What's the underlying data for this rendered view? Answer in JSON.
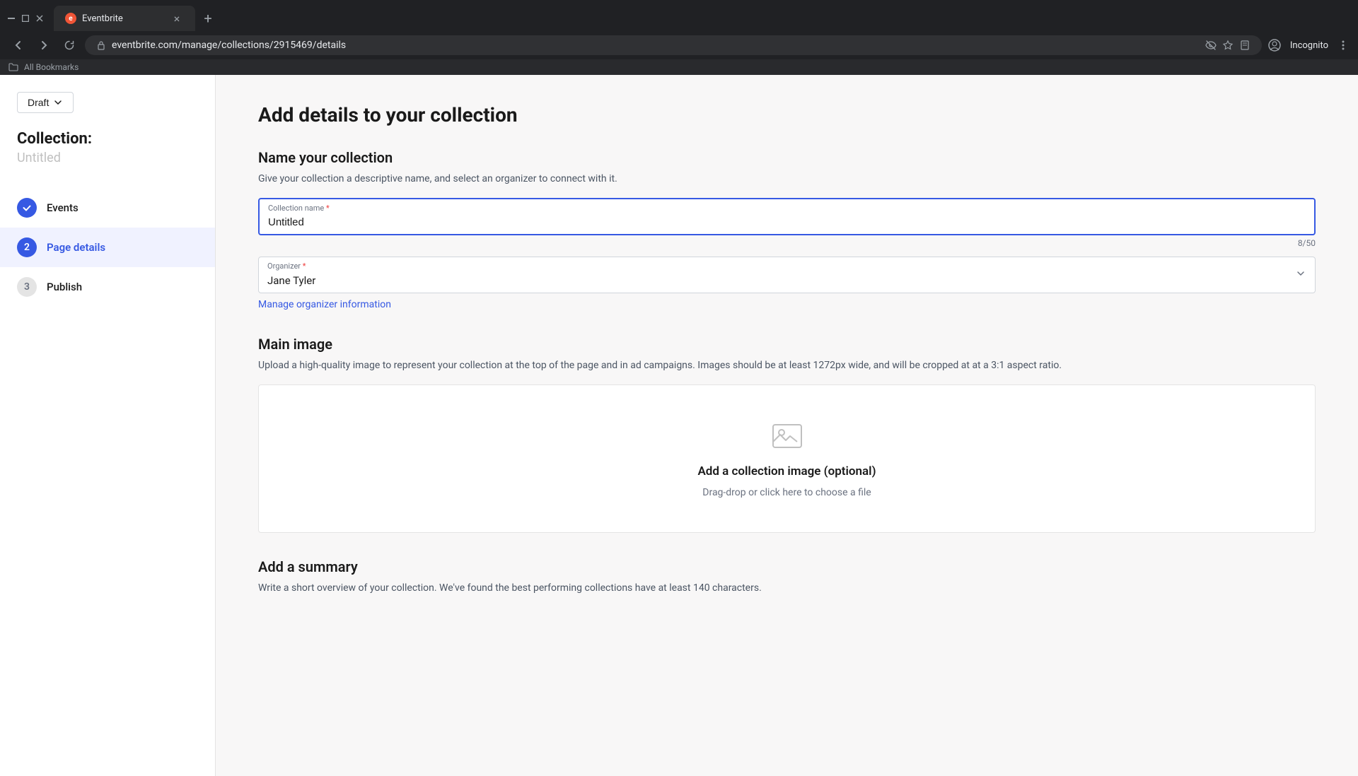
{
  "browser": {
    "tab_title": "Eventbrite",
    "tab_favicon": "e",
    "url": "eventbrite.com/manage/collections/2915469/details",
    "incognito_label": "Incognito",
    "bookmarks_label": "All Bookmarks"
  },
  "sidebar": {
    "draft_label": "Draft",
    "collection_label": "Collection:",
    "collection_subtitle": "Untitled",
    "nav_items": [
      {
        "step": "✓",
        "label": "Events",
        "state": "completed"
      },
      {
        "step": "2",
        "label": "Page details",
        "state": "active"
      },
      {
        "step": "3",
        "label": "Publish",
        "state": "pending"
      }
    ]
  },
  "main": {
    "page_title": "Add details to your collection",
    "name_section": {
      "title": "Name your collection",
      "desc": "Give your collection a descriptive name, and select an organizer to connect with it.",
      "field_label": "Collection name",
      "field_required": true,
      "field_value": "Untitled",
      "char_count": "8/50"
    },
    "organizer_section": {
      "label": "Organizer",
      "required": true,
      "value": "Jane Tyler",
      "manage_link": "Manage organizer information"
    },
    "image_section": {
      "title": "Main image",
      "desc": "Upload a high-quality image to represent your collection at the top of the page and in ad campaigns. Images should be at least 1272px wide, and will be cropped at at a 3:1 aspect ratio.",
      "upload_title": "Add a collection image (optional)",
      "upload_desc": "Drag-drop or click here to choose a file"
    },
    "summary_section": {
      "title": "Add a summary",
      "desc": "Write a short overview of your collection. We've found the best performing collections have at least 140 characters."
    }
  }
}
